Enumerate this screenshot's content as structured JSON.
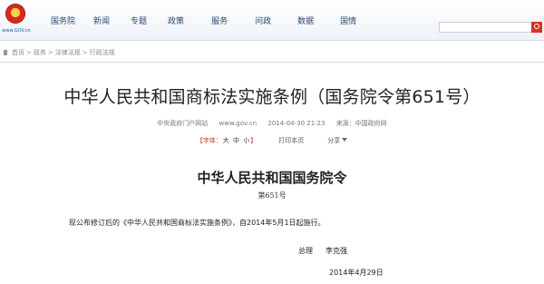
{
  "header": {
    "logo_text": "www.GOV.cn",
    "nav": [
      "国务院",
      "新闻",
      "专题",
      "政策",
      "服务",
      "问政",
      "数据",
      "国情"
    ],
    "search_placeholder": ""
  },
  "breadcrumb": [
    "首页",
    "政务",
    "法律法规",
    "行政法规"
  ],
  "article": {
    "title": "中华人民共和国商标法实施条例（国务院令第651号）",
    "meta": {
      "source": "中央政府门户网站",
      "site": "www.gov.cn",
      "time": "2014-04-30 21:23",
      "origin": "来源：中国政府网"
    },
    "toolbar": {
      "font_prefix": "【字体：",
      "sizes": [
        "大",
        "中",
        "小"
      ],
      "font_suffix": "】",
      "print": "打印本页",
      "share": "分享"
    }
  },
  "order": {
    "title": "中华人民共和国国务院令",
    "number": "第651号",
    "body": "现公布修订后的《中华人民共和国商标法实施条例》，自2014年5月1日起施行。",
    "sign_role": "总理",
    "sign_name": "李克强",
    "date": "2014年4月29日"
  },
  "colors": {
    "accent": "#d63324",
    "nav_text": "#2c4a73"
  }
}
